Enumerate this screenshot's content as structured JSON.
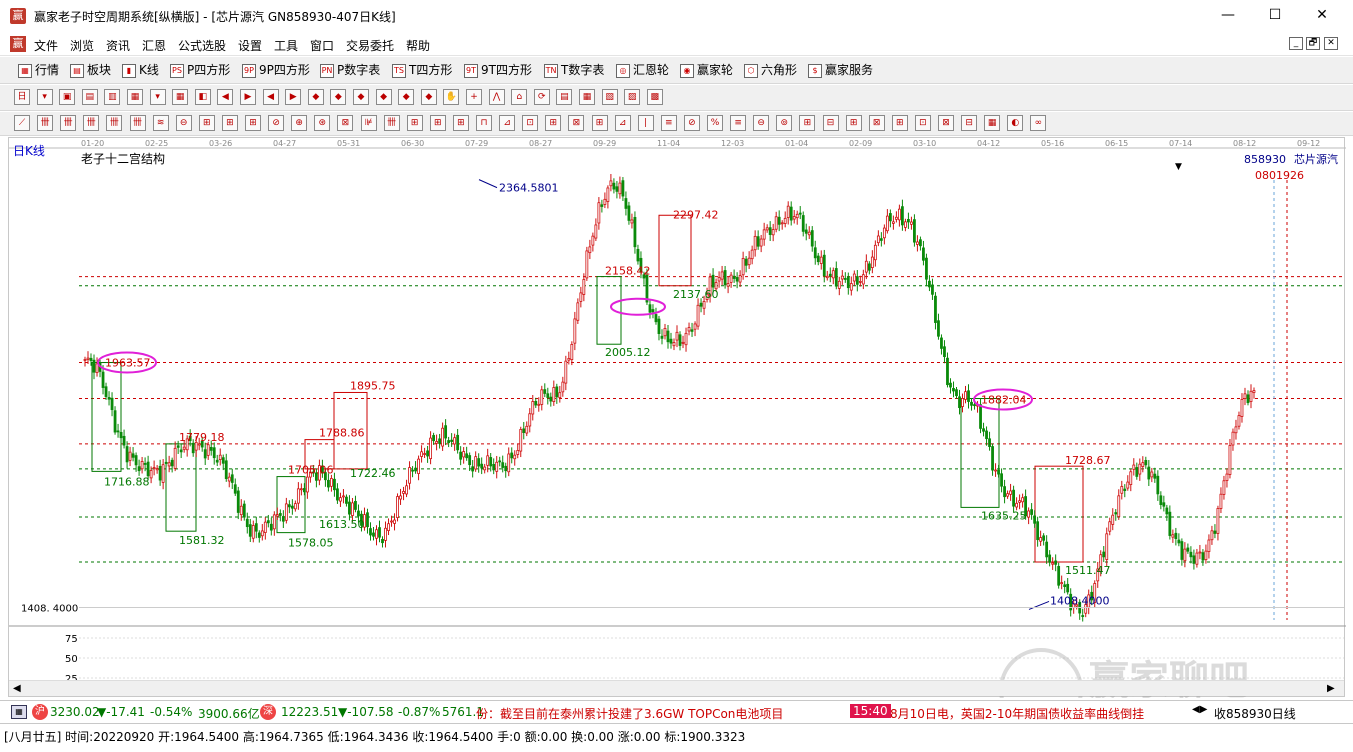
{
  "window": {
    "app_logo_text": "赢",
    "title": "赢家老子时空周期系统[纵横版] - [芯片源汽  GN858930-407日K线]",
    "minimize": "—",
    "maximize": "☐",
    "close": "✕"
  },
  "menu": {
    "items": [
      "文件",
      "浏览",
      "资讯",
      "汇恩",
      "公式选股",
      "设置",
      "工具",
      "窗口",
      "交易委托",
      "帮助"
    ],
    "mdi_buttons": [
      "_",
      "🗗",
      "✕"
    ]
  },
  "toolbar1": {
    "items": [
      "行情",
      "板块",
      "K线",
      "P四方形",
      "9P四方形",
      "P数字表",
      "T四方形",
      "9T四方形",
      "T数字表",
      "汇恩轮",
      "赢家轮",
      "六角形",
      "赢家服务"
    ],
    "icon_names": [
      "quote-icon",
      "sector-icon",
      "kline-icon",
      "p-square-icon",
      "9p-square-icon",
      "p-table-icon",
      "t-square-icon",
      "9t-square-icon",
      "t-table-icon",
      "huien-wheel-icon",
      "winner-wheel-icon",
      "hexagon-icon",
      "service-icon"
    ],
    "icon_glyphs": [
      "▦",
      "▤",
      "▮",
      "PS",
      "9P",
      "PN",
      "TS",
      "9T",
      "TN",
      "◎",
      "◉",
      "⬡",
      "$"
    ]
  },
  "toolbar2": {
    "glyphs": [
      "日",
      "▾",
      "▣",
      "▤",
      "▥",
      "▦",
      "▾",
      "▦",
      "◧",
      "◀",
      "▶",
      "◀",
      "▶",
      "◆",
      "◆",
      "◆",
      "◆",
      "◆",
      "◆",
      "✋",
      "+",
      "⋀",
      "⌂",
      "⟳",
      "▤",
      "▦",
      "▧",
      "▨",
      "▩"
    ]
  },
  "toolbar3": {
    "glyphs": [
      "⟋",
      "卌",
      "卌",
      "卌",
      "卌",
      "卌",
      "≋",
      "⊖",
      "⊞",
      "⊞",
      "⊞",
      "⊘",
      "⊕",
      "⊛",
      "⊠",
      "⊯",
      "卌",
      "⊞",
      "⊞",
      "⊞",
      "⊓",
      "⊿",
      "⊡",
      "⊞",
      "⊠",
      "⊞",
      "⊿",
      "|",
      "≡",
      "⊘",
      "%",
      "≡",
      "⊖",
      "⊚",
      "⊞",
      "⊟",
      "⊞",
      "⊠",
      "⊞",
      "⊡",
      "⊠",
      "⊟",
      "▦",
      "◐",
      "∞"
    ]
  },
  "chart": {
    "period_label": "日K线",
    "indicator_label": "老子十二宫结构",
    "stock_code": "858930",
    "stock_name": "芯片源汽",
    "red_dates": "0801926",
    "dropdown_arrow": "▼",
    "top_date_labels": [
      "01-20",
      "02-25",
      "03-26",
      "04-27",
      "05-31",
      "06-30",
      "07-29",
      "08-27",
      "09-29",
      "11-04",
      "12-03",
      "01-04",
      "02-09",
      "03-10",
      "04-12",
      "05-16",
      "06-15",
      "07-14",
      "08-12",
      "09-12"
    ],
    "y_axis_low_label": "1408. 4000",
    "sub_axis_labels": [
      "75",
      "50",
      "25"
    ],
    "price_labels": [
      {
        "text": "1963.57",
        "color": "#cc0000",
        "circled": true
      },
      {
        "text": "1716.88",
        "color": "#007700"
      },
      {
        "text": "1779.18",
        "color": "#cc0000"
      },
      {
        "text": "1581.32",
        "color": "#007700"
      },
      {
        "text": "1705.06",
        "color": "#cc0000"
      },
      {
        "text": "1578.05",
        "color": "#007700"
      },
      {
        "text": "1613.50",
        "color": "#007700"
      },
      {
        "text": "1788.86",
        "color": "#cc0000"
      },
      {
        "text": "1722.46",
        "color": "#007700"
      },
      {
        "text": "1895.75",
        "color": "#cc0000"
      },
      {
        "text": "2364.5801",
        "color": "#000088"
      },
      {
        "text": "2158.42",
        "color": "#cc0000"
      },
      {
        "text": "2005.12",
        "color": "#007700"
      },
      {
        "text": "2297.42",
        "color": "#cc0000"
      },
      {
        "text": "2137.60",
        "color": "#007700"
      },
      {
        "text": "1882.04",
        "color": "#cc0000",
        "circled": true
      },
      {
        "text": "1635.25",
        "color": "#007700"
      },
      {
        "text": "1728.67",
        "color": "#cc0000"
      },
      {
        "text": "1511.47",
        "color": "#007700"
      },
      {
        "text": "1408.4000",
        "color": "#000088"
      }
    ],
    "watermark": {
      "text": "赢家聊吧",
      "url": "liaoba.yjcf360.com"
    }
  },
  "chart_data": {
    "type": "candlestick",
    "title": "老子十二宫结构",
    "symbol": "858930",
    "name": "芯片源汽",
    "period": "日K线",
    "x_ticks": [
      "01-20",
      "02-25",
      "03-26",
      "04-27",
      "05-31",
      "06-30",
      "07-29",
      "08-27",
      "09-29",
      "11-04",
      "12-03",
      "01-04",
      "02-09",
      "03-10",
      "04-12",
      "05-16",
      "06-15",
      "07-14",
      "08-12",
      "09-12"
    ],
    "high": 2364.5801,
    "low": 1408.4,
    "ylim": [
      1380,
      2400
    ],
    "price_path": [
      1963.57,
      1716.88,
      1779.18,
      1581.32,
      1705.06,
      1578.05,
      1788.86,
      1722.46,
      1895.75,
      2364.58,
      2005.12,
      2158.42,
      2297.42,
      2137.6,
      2297.42,
      1882.04,
      1635.25,
      1408.4,
      1728.67,
      1511.47,
      1900.33
    ],
    "levels": [
      1963.57,
      1779.18,
      1722.46,
      1613.5,
      2158.42,
      2137.6,
      1882.04,
      1511.47,
      1408.4
    ],
    "sub_axis": [
      75,
      50,
      25
    ]
  },
  "statusbar1": {
    "sh_value": "3230.02",
    "sh_change": "▼-17.41",
    "sh_pct": "-0.54%",
    "sh_amount": "3900.66亿",
    "sz_value": "12223.51",
    "sz_change": "▼-107.58",
    "sz_pct": "-0.87%",
    "sz_amount": "5761.1",
    "news1": "份：截至目前在泰州累计投建了3.6GW TOPCon电池项目",
    "news_time": "15:40",
    "news2": "8月10日电，英国2-10年期国债收益率曲线倒挂",
    "status_right": "收858930日线"
  },
  "statusbar2": {
    "text": "[八月廿五] 时间:20220920 开:1964.5400 高:1964.7365 低:1964.3436 收:1964.5400 手:0 额:0.00 换:0.00 涨:0.00 标:1900.3323"
  }
}
